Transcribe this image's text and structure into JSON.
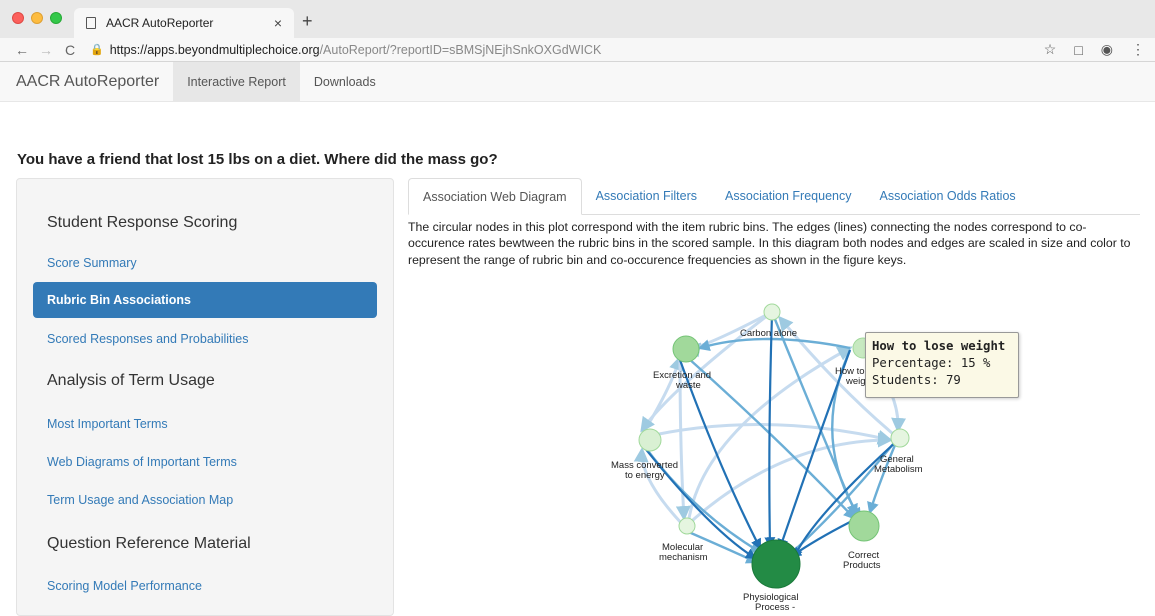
{
  "browser": {
    "tab_title": "AACR AutoReporter",
    "tab_close": "×",
    "new_tab": "+",
    "url_scheme": "https://",
    "url_host": "apps.beyondmultiplechoice.org",
    "url_path": "/AutoReport/?reportID=sBMSjNEjhSnkOXGdWICK",
    "back": "←",
    "forward": "→",
    "reload": "C",
    "star": "☆",
    "menu": "⋮"
  },
  "navbar": {
    "brand": "AACR AutoReporter",
    "links": [
      "Interactive Report",
      "Downloads"
    ],
    "active_index": 0
  },
  "question": "You have a friend that lost 15 lbs on a diet. Where did the mass go?",
  "sidebar": {
    "section1": "Student Response Scoring",
    "score_summary": "Score Summary",
    "rubric_bin_associations": "Rubric Bin Associations",
    "scored_responses": "Scored Responses and Probabilities",
    "section2": "Analysis of Term Usage",
    "most_important_terms": "Most Important Terms",
    "web_diagrams": "Web Diagrams of Important Terms",
    "term_usage_map": "Term Usage and Association Map",
    "section3": "Question Reference Material",
    "scoring_model": "Scoring Model Performance"
  },
  "tabs": [
    "Association Web Diagram",
    "Association Filters",
    "Association Frequency",
    "Association Odds Ratios"
  ],
  "description": "The circular nodes in this plot correspond with the item rubric bins. The edges (lines) connecting the nodes correspond to co-occurence rates bewtween the rubric bins in the scored sample. In this diagram both nodes and edges are scaled in size and color to represent the range of rubric bin and co-occurence frequencies as shown in the figure keys.",
  "diagram": {
    "nodes": {
      "carbon_alone": "Carbon alone",
      "how_to_lose_weight_a": "How to",
      "how_to_lose_weight_b": "weig",
      "excretion_a": "Excretion and",
      "excretion_b": "waste",
      "general_a": "General",
      "general_b": "Metabolism",
      "mass_converted_a": "Mass converted",
      "mass_converted_b": "to energy",
      "molecular_a": "Molecular",
      "molecular_b": "mechanism",
      "correct_a": "Correct",
      "correct_b": "Products",
      "physio_a": "Physiological",
      "physio_b": "Process -"
    },
    "colors": {
      "node_light": "#e5f5e0",
      "node_mid": "#a1d99b",
      "node_dark": "#238b45",
      "edge_light": "#c6dbef",
      "edge_mid": "#6baed6",
      "edge_dark": "#2171b5"
    }
  },
  "tooltip": {
    "title": "How to lose weight",
    "percentage": "Percentage: 15 %",
    "students": "Students: 79"
  }
}
